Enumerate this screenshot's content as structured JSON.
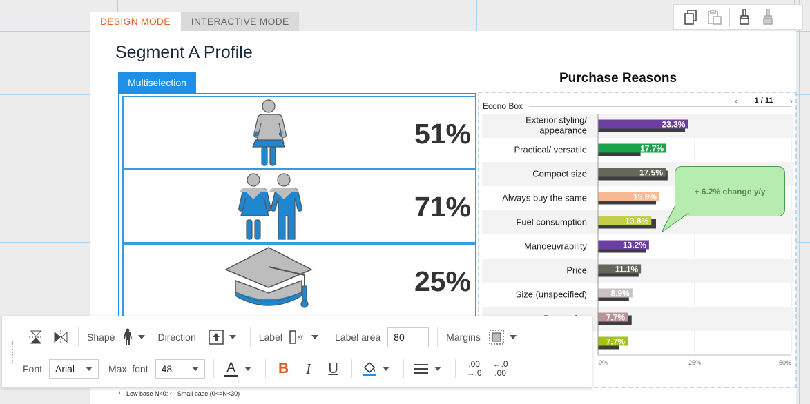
{
  "modes": {
    "design": "DESIGN MODE",
    "interactive": "INTERACTIVE MODE"
  },
  "page_title": "Segment A Profile",
  "multiselection_label": "Multiselection",
  "segments": [
    {
      "pct": "51%",
      "icon": "female-person-icon"
    },
    {
      "pct": "71%",
      "icon": "couple-icon"
    },
    {
      "pct": "25%",
      "icon": "graduation-cap-icon"
    }
  ],
  "chart_title": "Purchase Reasons",
  "group_label": "Econo Box",
  "pager": {
    "text": "1 / 11"
  },
  "callout_text": "+ 6.2% change y/y",
  "footnote": "¹ - Low base N<0;   ² - Small base (0<=N<30)",
  "chart_data": {
    "type": "bar",
    "orientation": "horizontal",
    "title": "Purchase Reasons",
    "categories": [
      "Exterior styling/ appearance",
      "Practical/ versatile",
      "Compact size",
      "Always buy the same",
      "Fuel consumption",
      "Manoeuvrability",
      "Price",
      "Size (unspecified)",
      "Reputation",
      ""
    ],
    "values": [
      23.3,
      17.7,
      17.5,
      15.9,
      13.8,
      13.2,
      11.1,
      8.9,
      7.7,
      7.7
    ],
    "value_labels": [
      "23.3%",
      "17.7%",
      "17.5%",
      "15.9%",
      "13.8%",
      "13.2%",
      "11.1%",
      "8.9%",
      "7.7%",
      "7.7%"
    ],
    "comparison_values": [
      22.5,
      11,
      18,
      15,
      15,
      12.5,
      10.5,
      8,
      8.7,
      5.5
    ],
    "colors": [
      "#6b3fa0",
      "#17a34a",
      "#66665a",
      "#f9b894",
      "#c3cf4a",
      "#6b3fa0",
      "#66665a",
      "#c8c2c2",
      "#b89398",
      "#a4c414"
    ],
    "xlim": [
      0,
      50
    ],
    "x_tick_labels": [
      "0%",
      "25%",
      "50%"
    ]
  },
  "toolbar_top": {
    "icons": [
      "copy-format-icon",
      "paste-format-icon",
      "brush-icon",
      "brush-fill-icon"
    ]
  },
  "format_toolbar": {
    "shape_label": "Shape",
    "direction_label": "Direction",
    "label_label": "Label",
    "label_area_label": "Label area",
    "label_area_value": "80",
    "margins_label": "Margins",
    "font_label": "Font",
    "font_value": "Arial",
    "max_font_label": "Max. font",
    "max_font_value": "48",
    "bold": "B",
    "italic": "I",
    "underline": "U",
    "text_color_glyph": "A",
    "decimal_increase": [
      ".00",
      "→.0"
    ],
    "decimal_decrease": [
      "←.0",
      ".00"
    ],
    "xy_glyph": "xy"
  }
}
